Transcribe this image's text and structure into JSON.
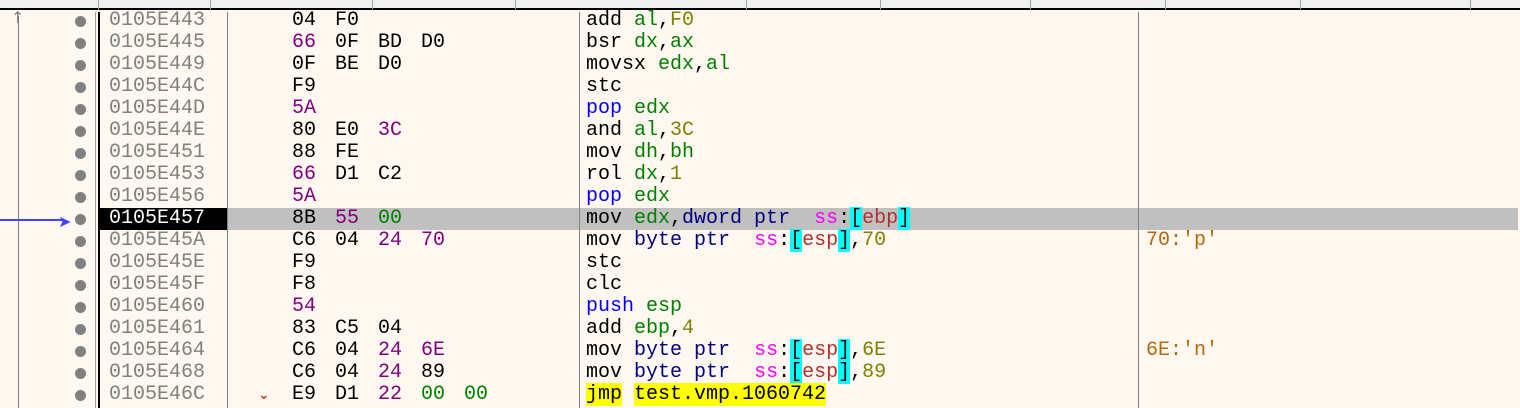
{
  "selected_index": 9,
  "colors": {
    "accent_arrow": "#4040ff",
    "selection": "#c0c0c0",
    "background": "#fff8f0"
  },
  "rows": [
    {
      "addr": "0105E443",
      "bytes": [
        [
          "04",
          "norm"
        ],
        [
          "F0",
          "norm"
        ]
      ],
      "instr": [
        [
          "add ",
          "norm"
        ],
        [
          "al",
          "reg"
        ],
        [
          ",",
          "norm"
        ],
        [
          "F0",
          "imm"
        ]
      ],
      "comment": ""
    },
    {
      "addr": "0105E445",
      "bytes": [
        [
          "66",
          "pfx"
        ],
        [
          "0F",
          "norm"
        ],
        [
          "BD",
          "norm"
        ],
        [
          "D0",
          "norm"
        ]
      ],
      "instr": [
        [
          "bsr ",
          "norm"
        ],
        [
          "dx",
          "reg"
        ],
        [
          ",",
          "norm"
        ],
        [
          "ax",
          "reg"
        ]
      ],
      "comment": ""
    },
    {
      "addr": "0105E449",
      "bytes": [
        [
          "0F",
          "norm"
        ],
        [
          "BE",
          "norm"
        ],
        [
          "D0",
          "norm"
        ]
      ],
      "instr": [
        [
          "movsx ",
          "norm"
        ],
        [
          "edx",
          "reg"
        ],
        [
          ",",
          "norm"
        ],
        [
          "al",
          "reg"
        ]
      ],
      "comment": ""
    },
    {
      "addr": "0105E44C",
      "bytes": [
        [
          "F9",
          "norm"
        ]
      ],
      "instr": [
        [
          "stc",
          "norm"
        ]
      ],
      "comment": ""
    },
    {
      "addr": "0105E44D",
      "bytes": [
        [
          "5A",
          "pfx"
        ]
      ],
      "instr": [
        [
          "pop ",
          "push"
        ],
        [
          "edx",
          "reg"
        ]
      ],
      "comment": ""
    },
    {
      "addr": "0105E44E",
      "bytes": [
        [
          "80",
          "norm"
        ],
        [
          "E0",
          "norm"
        ],
        [
          "3C",
          "pfx"
        ]
      ],
      "instr": [
        [
          "and ",
          "norm"
        ],
        [
          "al",
          "reg"
        ],
        [
          ",",
          "norm"
        ],
        [
          "3C",
          "imm"
        ]
      ],
      "comment": ""
    },
    {
      "addr": "0105E451",
      "bytes": [
        [
          "88",
          "norm"
        ],
        [
          "FE",
          "norm"
        ]
      ],
      "instr": [
        [
          "mov ",
          "norm"
        ],
        [
          "dh",
          "reg"
        ],
        [
          ",",
          "norm"
        ],
        [
          "bh",
          "reg"
        ]
      ],
      "comment": ""
    },
    {
      "addr": "0105E453",
      "bytes": [
        [
          "66",
          "pfx"
        ],
        [
          "D1",
          "norm"
        ],
        [
          "C2",
          "norm"
        ]
      ],
      "instr": [
        [
          "rol ",
          "norm"
        ],
        [
          "dx",
          "reg"
        ],
        [
          ",",
          "norm"
        ],
        [
          "1",
          "imm"
        ]
      ],
      "comment": ""
    },
    {
      "addr": "0105E456",
      "bytes": [
        [
          "5A",
          "pfx"
        ]
      ],
      "instr": [
        [
          "pop ",
          "push"
        ],
        [
          "edx",
          "reg"
        ]
      ],
      "comment": ""
    },
    {
      "addr": "0105E457",
      "bytes": [
        [
          "8B",
          "norm"
        ],
        [
          "55",
          "pfx"
        ],
        [
          "00",
          "zero"
        ]
      ],
      "instr": [
        [
          "mov ",
          "norm"
        ],
        [
          "edx",
          "reg"
        ],
        [
          ",",
          "norm"
        ],
        [
          "dword ptr ",
          "size"
        ],
        [
          " ",
          "norm"
        ],
        [
          "ss",
          "seg"
        ],
        [
          ":",
          "norm"
        ],
        [
          "[",
          "brk"
        ],
        [
          "ebp",
          "mreg"
        ],
        [
          "]",
          "brk"
        ]
      ],
      "comment": ""
    },
    {
      "addr": "0105E45A",
      "bytes": [
        [
          "C6",
          "norm"
        ],
        [
          "04",
          "norm"
        ],
        [
          "24",
          "pfx"
        ],
        [
          "70",
          "pfx"
        ]
      ],
      "instr": [
        [
          "mov ",
          "norm"
        ],
        [
          "byte ptr ",
          "size"
        ],
        [
          " ",
          "norm"
        ],
        [
          "ss",
          "seg"
        ],
        [
          ":",
          "norm"
        ],
        [
          "[",
          "brk"
        ],
        [
          "esp",
          "mreg"
        ],
        [
          "]",
          "brk"
        ],
        [
          ",",
          "norm"
        ],
        [
          "70",
          "imm"
        ]
      ],
      "comment": "70:'p'"
    },
    {
      "addr": "0105E45E",
      "bytes": [
        [
          "F9",
          "norm"
        ]
      ],
      "instr": [
        [
          "stc",
          "norm"
        ]
      ],
      "comment": ""
    },
    {
      "addr": "0105E45F",
      "bytes": [
        [
          "F8",
          "norm"
        ]
      ],
      "instr": [
        [
          "clc",
          "norm"
        ]
      ],
      "comment": ""
    },
    {
      "addr": "0105E460",
      "bytes": [
        [
          "54",
          "pfx"
        ]
      ],
      "instr": [
        [
          "push ",
          "push"
        ],
        [
          "esp",
          "reg"
        ]
      ],
      "comment": ""
    },
    {
      "addr": "0105E461",
      "bytes": [
        [
          "83",
          "norm"
        ],
        [
          "C5",
          "norm"
        ],
        [
          "04",
          "norm"
        ]
      ],
      "instr": [
        [
          "add ",
          "norm"
        ],
        [
          "ebp",
          "reg"
        ],
        [
          ",",
          "norm"
        ],
        [
          "4",
          "imm"
        ]
      ],
      "comment": ""
    },
    {
      "addr": "0105E464",
      "bytes": [
        [
          "C6",
          "norm"
        ],
        [
          "04",
          "norm"
        ],
        [
          "24",
          "pfx"
        ],
        [
          "6E",
          "pfx"
        ]
      ],
      "instr": [
        [
          "mov ",
          "norm"
        ],
        [
          "byte ptr ",
          "size"
        ],
        [
          " ",
          "norm"
        ],
        [
          "ss",
          "seg"
        ],
        [
          ":",
          "norm"
        ],
        [
          "[",
          "brk"
        ],
        [
          "esp",
          "mreg"
        ],
        [
          "]",
          "brk"
        ],
        [
          ",",
          "norm"
        ],
        [
          "6E",
          "imm"
        ]
      ],
      "comment": "6E:'n'"
    },
    {
      "addr": "0105E468",
      "bytes": [
        [
          "C6",
          "norm"
        ],
        [
          "04",
          "norm"
        ],
        [
          "24",
          "pfx"
        ],
        [
          "89",
          "norm"
        ]
      ],
      "instr": [
        [
          "mov ",
          "norm"
        ],
        [
          "byte ptr ",
          "size"
        ],
        [
          " ",
          "norm"
        ],
        [
          "ss",
          "seg"
        ],
        [
          ":",
          "norm"
        ],
        [
          "[",
          "brk"
        ],
        [
          "esp",
          "mreg"
        ],
        [
          "]",
          "brk"
        ],
        [
          ",",
          "norm"
        ],
        [
          "89",
          "imm"
        ]
      ],
      "comment": ""
    },
    {
      "addr": "0105E46C",
      "jump": true,
      "bytes": [
        [
          "E9",
          "norm"
        ],
        [
          "D1",
          "norm"
        ],
        [
          "22",
          "pfx"
        ],
        [
          "00",
          "zero"
        ],
        [
          "00",
          "zero"
        ]
      ],
      "instr": [
        [
          "jmp",
          "jmp"
        ],
        [
          " ",
          "norm"
        ],
        [
          "test.vmp.1060742",
          "jmp"
        ]
      ],
      "comment": ""
    }
  ]
}
